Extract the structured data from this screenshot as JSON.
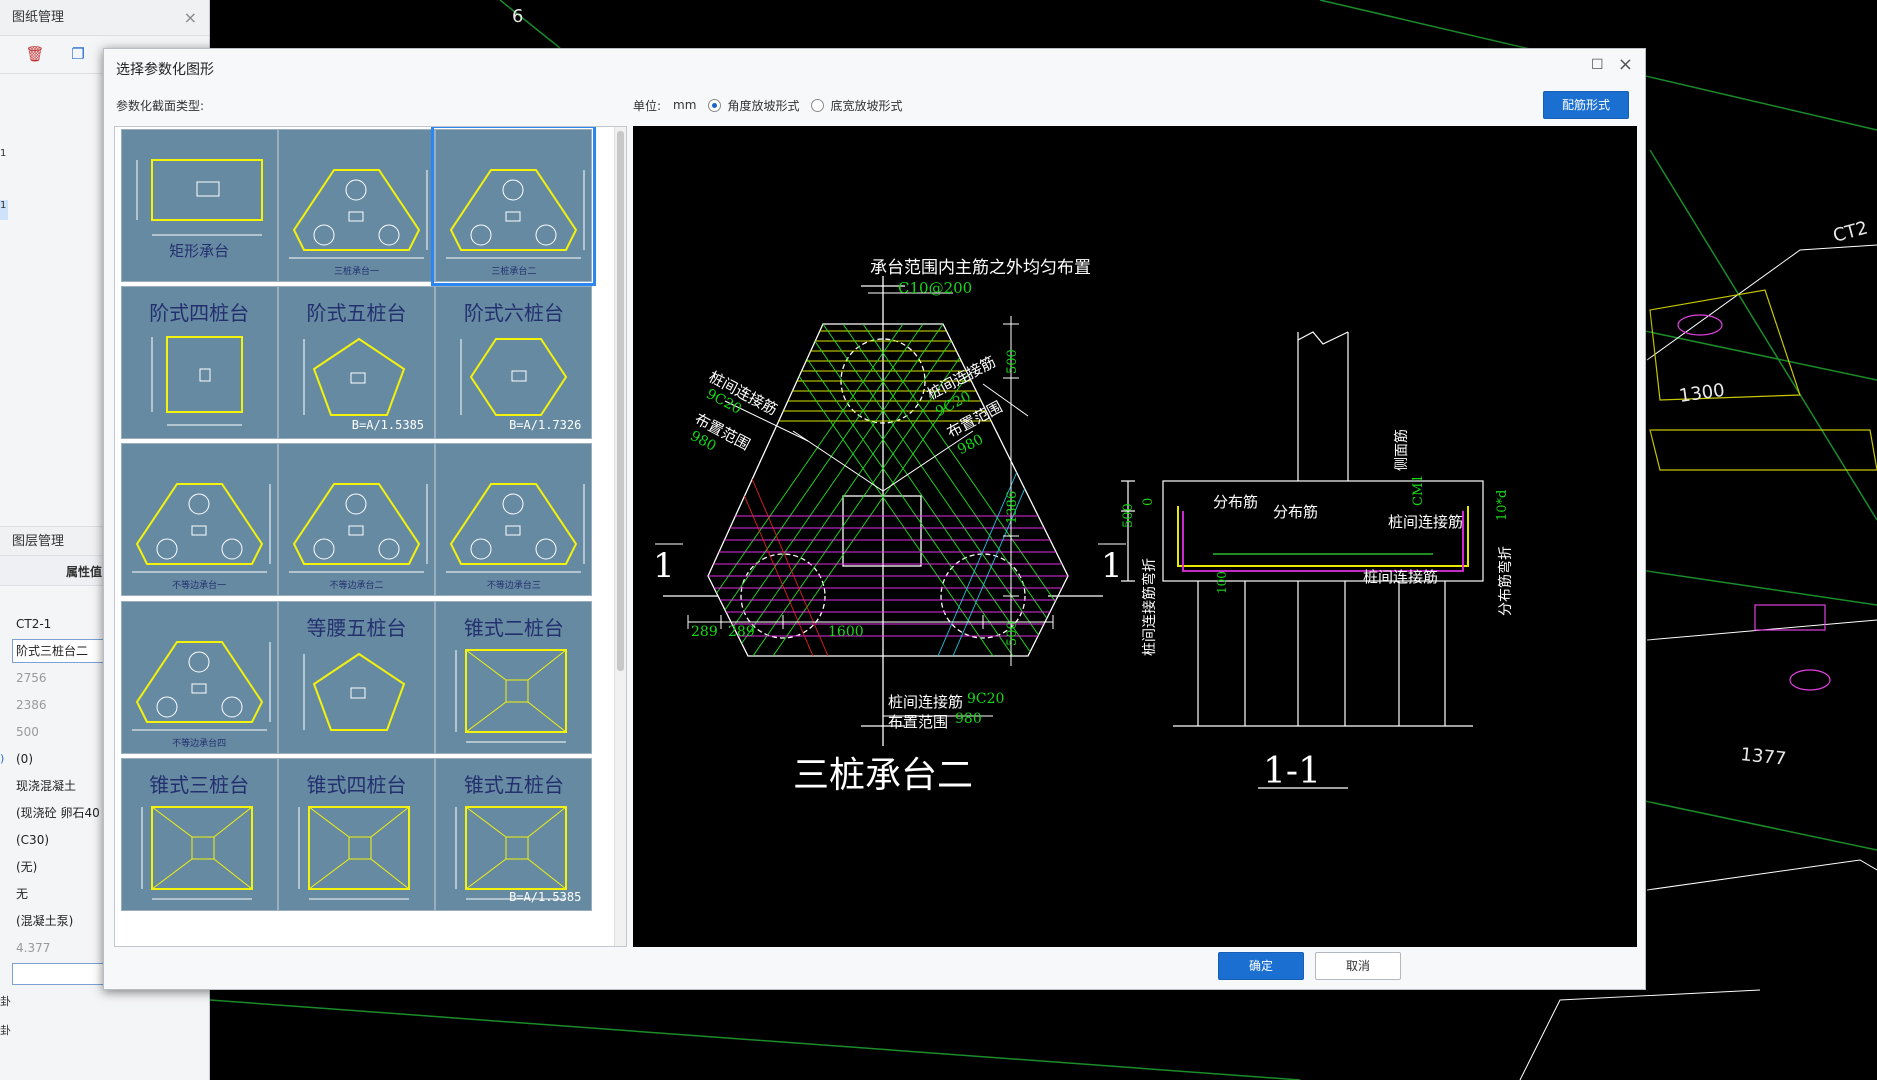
{
  "left_panel": {
    "title": "图纸管理",
    "layer_title": "图层管理",
    "prop_header": "属性值",
    "props": [
      "CT2-1",
      "阶式三桩台二",
      "2756",
      "2386",
      "500",
      "(0)",
      "现浇混凝土",
      "(现浇砼 卵石40",
      "(C30)",
      "(无)",
      "无",
      "(混凝土泵)",
      "4.377"
    ],
    "row_marks": [
      "1",
      "1",
      ")",
      "卦",
      "卦"
    ]
  },
  "dialog": {
    "title": "选择参数化图形",
    "section_label": "参数化截面类型:",
    "unit_label": "单位:",
    "unit_value": "mm",
    "radio_angle": "角度放坡形式",
    "radio_width": "底宽放坡形式",
    "rebar_button": "配筋形式",
    "ok_button": "确定",
    "cancel_button": "取消"
  },
  "tiles": [
    {
      "type": "rect",
      "title": "",
      "caption": "矩形承台",
      "sel": false
    },
    {
      "type": "tri",
      "title": "",
      "caption": "三桩承台一",
      "sel": false
    },
    {
      "type": "tri",
      "title": "",
      "caption": "三桩承台二",
      "sel": true
    },
    {
      "type": "sq",
      "title": "阶式四桩台",
      "caption": "",
      "formula": "",
      "sel": false
    },
    {
      "type": "pent",
      "title": "阶式五桩台",
      "caption": "",
      "formula": "B=A/1.5385",
      "sel": false
    },
    {
      "type": "hex",
      "title": "阶式六桩台",
      "caption": "",
      "formula": "B=A/1.7326",
      "sel": false
    },
    {
      "type": "tri",
      "title": "",
      "caption": "不等边承台一",
      "sel": false
    },
    {
      "type": "tri",
      "title": "",
      "caption": "不等边承台二",
      "sel": false
    },
    {
      "type": "tri",
      "title": "",
      "caption": "不等边承台三",
      "sel": false
    },
    {
      "type": "tri",
      "title": "",
      "caption": "不等边承台四",
      "sel": false
    },
    {
      "type": "pent2",
      "title": "等腰五桩台",
      "caption": "",
      "sel": false
    },
    {
      "type": "cone",
      "title": "锥式二桩台",
      "caption": "",
      "formula": "",
      "sel": false
    },
    {
      "type": "cone",
      "title": "锥式三桩台",
      "caption": "",
      "formula": "",
      "sel": false
    },
    {
      "type": "cone",
      "title": "锥式四桩台",
      "caption": "",
      "formula": "",
      "sel": false
    },
    {
      "type": "cone",
      "title": "锥式五桩台",
      "caption": "",
      "formula": "B=A/1.5385",
      "sel": false
    }
  ],
  "preview": {
    "plan_title": "三桩承台二",
    "section_title": "1-1",
    "note_main": "承台范围内主筋之外均匀布置",
    "rebar_c10": "C10@200",
    "label_link_rebar": "桩间连接筋",
    "label_9c20": "9C20",
    "label_range": "布置范围",
    "label_980": "980",
    "dim_500": "500",
    "dim_1386": "1386",
    "dim_289": "289",
    "dim_1600": "1600",
    "section_mark": "1",
    "label_dist": "分布筋",
    "label_side": "侧面筋",
    "label_cm1": "CM1",
    "label_10d": "10*d",
    "label_dist_bend": "分布筋弯折",
    "label_link_bend": "桩间连接筋弯折",
    "dim_0": "0",
    "dim_100": "100"
  },
  "background": {
    "labels": [
      "6",
      "1300",
      "1377",
      "CT2"
    ]
  }
}
